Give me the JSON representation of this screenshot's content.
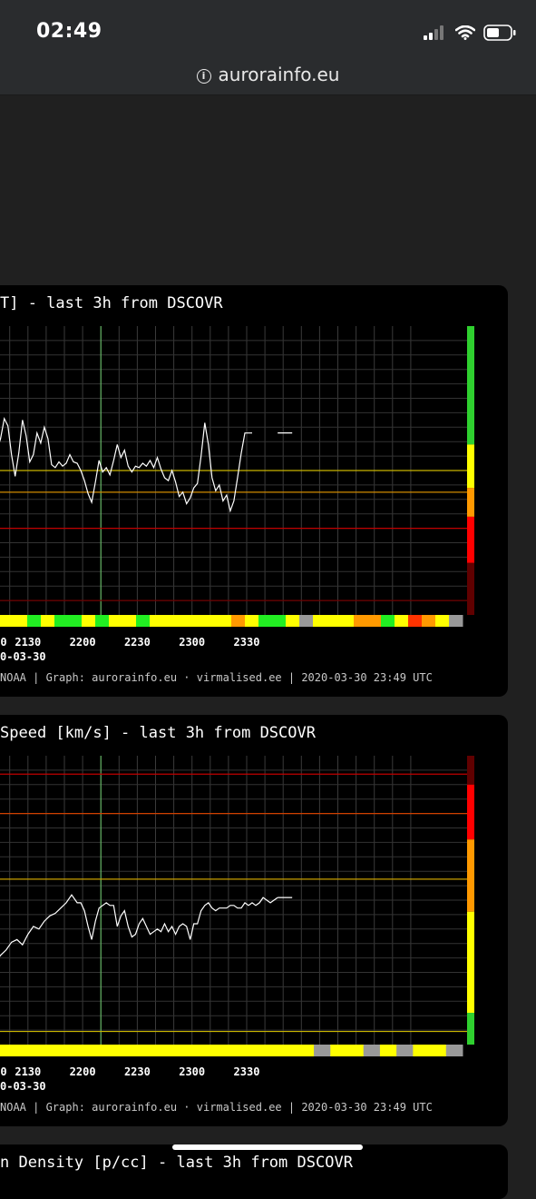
{
  "status_bar": {
    "time": "02:49",
    "icons": [
      "signal-icon",
      "wifi-icon",
      "battery-icon"
    ]
  },
  "browser": {
    "url": "aurorainfo.eu",
    "info_icon": "info-icon"
  },
  "charts": [
    {
      "title": "T] - last 3h from DSCOVR",
      "date_label": "0-03-30",
      "credit": "NOAA | Graph: aurorainfo.eu · virmalised.ee | 2020-03-30 23:49 UTC",
      "x_ticks": [
        "0",
        "2130",
        "2200",
        "2230",
        "2300",
        "2330"
      ]
    },
    {
      "title": "Speed [km/s] - last 3h from DSCOVR",
      "date_label": "0-03-30",
      "credit": "NOAA | Graph: aurorainfo.eu · virmalised.ee | 2020-03-30 23:49 UTC",
      "x_ticks": [
        "0",
        "2130",
        "2200",
        "2230",
        "2300",
        "2330"
      ]
    },
    {
      "title": "n Density [p/cc] - last 3h from DSCOVR"
    }
  ],
  "chart_data": [
    {
      "type": "line",
      "title": "T] - last 3h from DSCOVR",
      "x_ticks": [
        "2130",
        "2200",
        "2230",
        "2300",
        "2330"
      ],
      "x": [
        2100,
        2103,
        2106,
        2109,
        2112,
        2115,
        2117,
        2119,
        2121,
        2123,
        2125,
        2127,
        2129,
        2131,
        2133,
        2135,
        2137,
        2139,
        2141,
        2143,
        2145,
        2147,
        2149,
        2151,
        2153,
        2155,
        2157,
        2159,
        2201,
        2203,
        2205,
        2207,
        2209,
        2211,
        2213,
        2215,
        2217,
        2219,
        2221,
        2223,
        2225,
        2227,
        2229,
        2231,
        2233,
        2235,
        2237,
        2239,
        2241,
        2243,
        2245,
        2247,
        2249,
        2251,
        2253,
        2255,
        2257,
        2259,
        2301,
        2303,
        2305,
        2307,
        2309,
        2311,
        2313,
        2315,
        2317,
        2319,
        2321,
        2323,
        2325,
        2327,
        2329,
        2331,
        2333,
        2335,
        2337,
        2339,
        2341,
        2343,
        2345,
        2347
      ],
      "y": [
        0.5,
        0.7,
        0.8,
        0.6,
        1.0,
        2.2,
        3.6,
        3.1,
        1.1,
        -0.4,
        1.2,
        3.5,
        2.4,
        0.6,
        1.1,
        2.6,
        1.9,
        3.0,
        2.2,
        0.4,
        0.2,
        0.6,
        0.3,
        0.5,
        1.1,
        0.6,
        0.5,
        0.0,
        -0.7,
        -1.6,
        -2.2,
        -0.8,
        0.7,
        -0.1,
        0.2,
        -0.3,
        0.7,
        1.8,
        0.9,
        1.4,
        0.3,
        -0.1,
        0.3,
        0.2,
        0.5,
        0.3,
        0.7,
        0.2,
        0.9,
        0.1,
        -0.5,
        -0.7,
        0.0,
        -0.8,
        -1.8,
        -1.5,
        -2.3,
        -1.9,
        -1.2,
        -0.9,
        1.0,
        3.3,
        1.8,
        -0.5,
        -1.4,
        -1.0,
        -2.1,
        -1.7,
        -2.8,
        -2.1,
        -0.5,
        1.2,
        2.6,
        2.6,
        2.6
      ],
      "thresholds": [
        {
          "value": 0,
          "color": "#c8b400"
        },
        {
          "value": -1.5,
          "color": "#d08a00"
        },
        {
          "value": -4,
          "color": "#c00000"
        },
        {
          "value": -9,
          "color": "#700000"
        }
      ],
      "level_bar": [
        "#2fd02f",
        "#ffff00",
        "#ff9900",
        "#ff0000",
        "#600000"
      ],
      "status_strip": [
        "#ffff00",
        "#ffff00",
        "#22ee22",
        "#ffff00",
        "#22ee22",
        "#22ee22",
        "#ffff00",
        "#22ee22",
        "#ffff00",
        "#ffff00",
        "#22ee22",
        "#ffff00",
        "#ffff00",
        "#ffff00",
        "#ffff00",
        "#ffff00",
        "#ffff00",
        "#ff9900",
        "#ffff00",
        "#22ee22",
        "#22ee22",
        "#ffff00",
        "#999999",
        "#ffff00",
        "#ffff00",
        "#ffff00",
        "#ff9900",
        "#ff9900",
        "#22ee22",
        "#ffff00",
        "#ff3300",
        "#ff9900",
        "#ffff00",
        "#999999"
      ]
    },
    {
      "type": "line",
      "title": "Speed [km/s] - last 3h from DSCOVR",
      "x_ticks": [
        "2130",
        "2200",
        "2230",
        "2300",
        "2330"
      ],
      "x": [
        2100,
        2103,
        2106,
        2109,
        2112,
        2115,
        2118,
        2121,
        2124,
        2127,
        2130,
        2133,
        2136,
        2139,
        2142,
        2145,
        2148,
        2151,
        2154,
        2157,
        2159,
        2201,
        2203,
        2205,
        2207,
        2209,
        2211,
        2213,
        2215,
        2217,
        2219,
        2221,
        2223,
        2225,
        2227,
        2229,
        2231,
        2233,
        2235,
        2237,
        2239,
        2241,
        2243,
        2245,
        2247,
        2249,
        2251,
        2253,
        2255,
        2257,
        2259,
        2301,
        2303,
        2305,
        2307,
        2309,
        2311,
        2313,
        2315,
        2317,
        2319,
        2321,
        2323,
        2325,
        2327,
        2329,
        2331,
        2333,
        2335,
        2337,
        2339,
        2341,
        2343,
        2345,
        2347
      ],
      "y": [
        -27,
        -21,
        -19,
        -20,
        -24,
        -21,
        -19,
        -16,
        -15,
        -17,
        -13,
        -10,
        -11,
        -8,
        -6,
        -5,
        -3,
        -1,
        2,
        -1,
        -1,
        -4,
        -10,
        -15,
        -8,
        -3,
        -2,
        -1,
        -2,
        -2,
        -10,
        -6,
        -4,
        -10,
        -14,
        -13,
        -9,
        -7,
        -10,
        -13,
        -12,
        -11,
        -12,
        -9,
        -12,
        -10,
        -13,
        -10,
        -9,
        -10,
        -15,
        -9,
        -9,
        -4,
        -2,
        -1,
        -3,
        -4,
        -3,
        -3,
        -3,
        -2,
        -2,
        -3,
        -3,
        -1,
        -2,
        -1,
        -2,
        -1,
        1,
        0,
        -1,
        0,
        1
      ],
      "thresholds": [
        {
          "value": 8,
          "color": "#c8a000"
        },
        {
          "value": 33,
          "color": "#d04000"
        },
        {
          "value": 48,
          "color": "#c00000"
        },
        {
          "value": -50,
          "color": "#c8b400"
        }
      ],
      "level_bar": [
        "#600000",
        "#ff0000",
        "#ff9900",
        "#ffff00",
        "#2fd02f"
      ],
      "status_strip": [
        "#ffff00",
        "#ffff00",
        "#ffff00",
        "#ffff00",
        "#ffff00",
        "#ffff00",
        "#ffff00",
        "#ffff00",
        "#ffff00",
        "#ffff00",
        "#ffff00",
        "#ffff00",
        "#ffff00",
        "#ffff00",
        "#ffff00",
        "#ffff00",
        "#ffff00",
        "#ffff00",
        "#ffff00",
        "#999999",
        "#ffff00",
        "#ffff00",
        "#999999",
        "#ffff00",
        "#999999",
        "#ffff00",
        "#ffff00",
        "#999999"
      ]
    }
  ]
}
